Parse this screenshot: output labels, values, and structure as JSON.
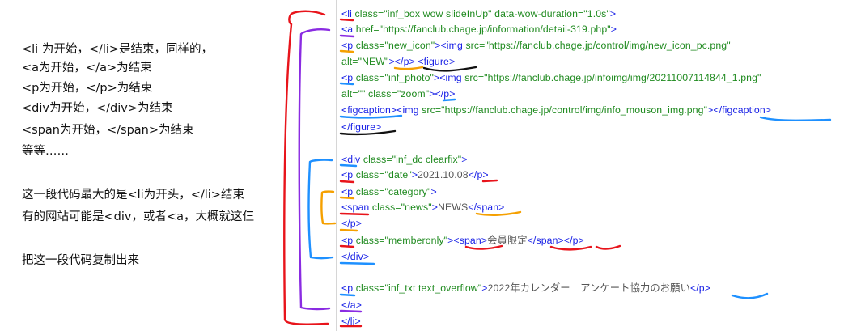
{
  "notes": [
    "<li 为开始，</li>是结束，同样的，",
    "<a为开始，</a>为结束",
    "<p为开始，</p>为结束",
    "<div为开始，</div>为结束",
    "<span为开始，</span>为结束",
    "等等……",
    "",
    "这一段代码最大的是<li为开头，</li>结束",
    "有的网站可能是<div，或者<a，大概就这仨",
    "",
    "把这一段代码复制出来"
  ],
  "code_lines": [
    [
      [
        "tag",
        "<li"
      ],
      [
        "attr",
        " class=\"inf_box wow slideInUp\" data-wow-duration=\"1.0s\""
      ],
      [
        "tag",
        ">"
      ]
    ],
    [
      [
        "tag",
        "<a"
      ],
      [
        "attr",
        " href=\"https://fanclub.chage.jp/information/detail-319.php\""
      ],
      [
        "tag",
        ">"
      ]
    ],
    [
      [
        "tag",
        "<p"
      ],
      [
        "attr",
        " class=\"new_icon\""
      ],
      [
        "tag",
        "><img"
      ],
      [
        "attr",
        " src=\"https://fanclub.chage.jp/control/img/new_icon_pc.png\""
      ]
    ],
    [
      [
        "attr",
        "alt=\"NEW\""
      ],
      [
        "tag",
        "></p>  <figure>"
      ]
    ],
    [
      [
        "tag",
        "<p"
      ],
      [
        "attr",
        " class=\"inf_photo\""
      ],
      [
        "tag",
        "><img"
      ],
      [
        "attr",
        " src=\"https://fanclub.chage.jp/infoimg/img/20211007114844_1.png\""
      ]
    ],
    [
      [
        "attr",
        "alt=\"\" class=\"zoom\""
      ],
      [
        "tag",
        "></p>"
      ]
    ],
    [
      [
        "tag",
        "<figcaption><img"
      ],
      [
        "attr",
        " src=\"https://fanclub.chage.jp/control/img/info_mouson_img.png\""
      ],
      [
        "tag",
        "></figcaption>"
      ]
    ],
    [
      [
        "tag",
        "</figure>"
      ]
    ],
    [],
    [
      [
        "tag",
        "<div"
      ],
      [
        "attr",
        " class=\"inf_dc clearfix\""
      ],
      [
        "tag",
        ">"
      ]
    ],
    [
      [
        "tag",
        "<p"
      ],
      [
        "attr",
        " class=\"date\""
      ],
      [
        "tag",
        ">"
      ],
      [
        "text",
        "2021.10.08"
      ],
      [
        "tag",
        "</p>"
      ]
    ],
    [
      [
        "tag",
        "<p"
      ],
      [
        "attr",
        " class=\"category\""
      ],
      [
        "tag",
        ">"
      ]
    ],
    [
      [
        "tag",
        "<span"
      ],
      [
        "attr",
        " class=\"news\""
      ],
      [
        "tag",
        ">"
      ],
      [
        "text",
        "NEWS"
      ],
      [
        "tag",
        "</span>"
      ]
    ],
    [
      [
        "tag",
        "</p>"
      ]
    ],
    [
      [
        "tag",
        "<p"
      ],
      [
        "attr",
        " class=\"memberonly\""
      ],
      [
        "tag",
        "><span>"
      ],
      [
        "text",
        "会員限定"
      ],
      [
        "tag",
        "</span></p>"
      ]
    ],
    [
      [
        "tag",
        "</div>"
      ]
    ],
    [],
    [
      [
        "tag",
        "<p"
      ],
      [
        "attr",
        " class=\"inf_txt text_overflow\""
      ],
      [
        "tag",
        ">"
      ],
      [
        "text",
        "2022年カレンダー　アンケート協力のお願い"
      ],
      [
        "tag",
        "</p>"
      ]
    ],
    [
      [
        "tag",
        "</a>"
      ]
    ],
    [
      [
        "tag",
        "</li>"
      ]
    ]
  ],
  "annotation_colors": {
    "red": "#e8141b",
    "purple": "#8a2be2",
    "blue": "#1e90ff",
    "orange": "#f5a000",
    "black": "#111111"
  }
}
